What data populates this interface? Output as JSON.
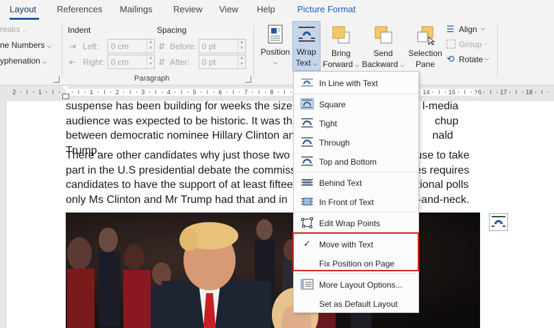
{
  "tabs": [
    {
      "label": "Layout",
      "active": true
    },
    {
      "label": "References"
    },
    {
      "label": "Mailings"
    },
    {
      "label": "Review"
    },
    {
      "label": "View"
    },
    {
      "label": "Help"
    },
    {
      "label": "Picture Format",
      "accent": true
    }
  ],
  "ribbon": {
    "page_setup": {
      "breaks": "reaks",
      "line_numbers": "ne Numbers",
      "hyphenation": "yphenation"
    },
    "paragraph": {
      "indent_heading": "Indent",
      "spacing_heading": "Spacing",
      "left_label": "Left:",
      "right_label": "Right:",
      "before_label": "Before:",
      "after_label": "After:",
      "left_value": "0 cm",
      "right_value": "0 cm",
      "before_value": "0 pt",
      "after_value": "0 pt",
      "group_label": "Paragraph"
    },
    "arrange": {
      "position": "Position",
      "wrap_text_1": "Wrap",
      "wrap_text_2": "Text",
      "bring_forward_1": "Bring",
      "bring_forward_2": "Forward",
      "send_backward_1": "Send",
      "send_backward_2": "Backward",
      "selection_pane_1": "Selection",
      "selection_pane_2": "Pane",
      "align": "Align",
      "group": "Group",
      "rotate": "Rotate"
    }
  },
  "ruler": {
    "left_numbers": [
      "2",
      "1"
    ],
    "numbers": [
      "1",
      "2",
      "3",
      "4",
      "5",
      "6",
      "7",
      "8",
      "9",
      "10",
      "11",
      "12",
      "13",
      "14",
      "15",
      "16",
      "17",
      "18"
    ]
  },
  "document": {
    "para1": [
      "suspense has been building for weeks the size",
      "l-media",
      "audience was expected to be historic. It was th",
      "chup",
      "between democratic nominee Hillary Clinton an",
      "nald Trump."
    ],
    "para2": [
      "There are other candidates why just those two",
      "use to take",
      "part in the U.S presidential debate the commiss",
      "es requires",
      "candidates to have the support of at least fiftee",
      "tional polls",
      "only Ms Clinton and Mr Trump had that and in",
      "-and-neck."
    ]
  },
  "wrap_menu": {
    "items": [
      {
        "label": "In Line with Text",
        "icon": "inline-icon"
      },
      {
        "label": "Square",
        "icon": "square-wrap-icon",
        "selected": true
      },
      {
        "label": "Tight",
        "icon": "tight-wrap-icon"
      },
      {
        "label": "Through",
        "icon": "through-wrap-icon"
      },
      {
        "label": "Top and Bottom",
        "icon": "top-bottom-wrap-icon"
      },
      {
        "label": "Behind Text",
        "icon": "behind-text-icon"
      },
      {
        "label": "In Front of Text",
        "icon": "in-front-text-icon"
      },
      {
        "label": "Edit Wrap Points",
        "icon": "edit-wrap-points-icon"
      },
      {
        "label": "Move with Text",
        "icon": "checkmark-icon",
        "checked": true
      },
      {
        "label": "Fix Position on Page"
      },
      {
        "label": "More Layout Options...",
        "icon": "layout-options-icon"
      },
      {
        "label": "Set as Default Layout"
      }
    ]
  },
  "colors": {
    "accent": "#2b579a",
    "highlight": "#d32020",
    "selected_bg": "#c5d9f1"
  }
}
